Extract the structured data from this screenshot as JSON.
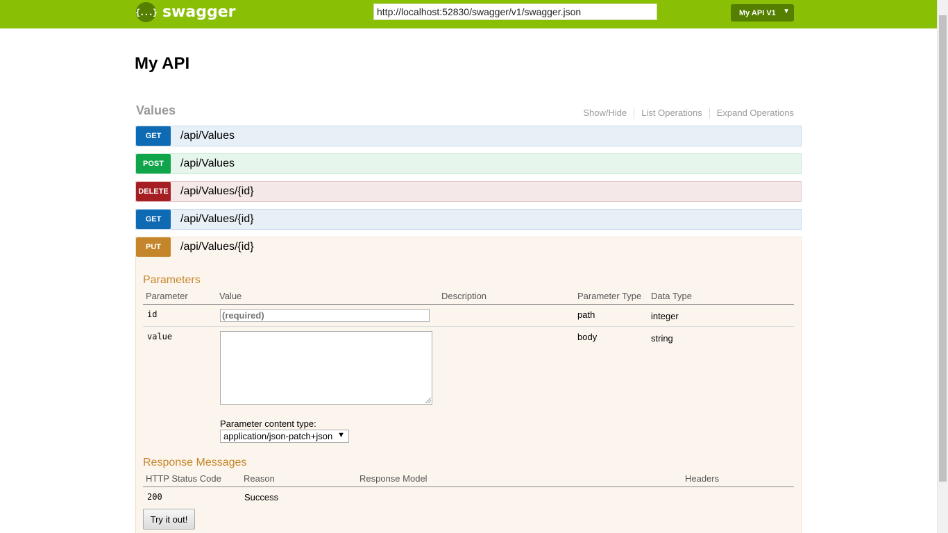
{
  "header": {
    "logo_icon_glyph": "{...}",
    "logo_text": "swagger",
    "url_value": "http://localhost:52830/swagger/v1/swagger.json",
    "api_selector": "My API V1",
    "background_color": "#89bf04"
  },
  "page_title": "My API",
  "section": {
    "title": "Values",
    "links": [
      "Show/Hide",
      "List Operations",
      "Expand Operations"
    ]
  },
  "operations": [
    {
      "verb": "GET",
      "path": "/api/Values",
      "color": "#0f6ab4"
    },
    {
      "verb": "POST",
      "path": "/api/Values",
      "color": "#10a54a"
    },
    {
      "verb": "DELETE",
      "path": "/api/Values/{id}",
      "color": "#a41e22"
    },
    {
      "verb": "GET",
      "path": "/api/Values/{id}",
      "color": "#0f6ab4"
    },
    {
      "verb": "PUT",
      "path": "/api/Values/{id}",
      "color": "#c5862b"
    }
  ],
  "put_details": {
    "parameters_heading": "Parameters",
    "param_columns": [
      "Parameter",
      "Value",
      "Description",
      "Parameter Type",
      "Data Type"
    ],
    "params": [
      {
        "name": "id",
        "placeholder": "(required)",
        "param_type": "path",
        "data_type": "integer"
      },
      {
        "name": "value",
        "param_type": "body",
        "data_type": "string"
      }
    ],
    "content_type_label": "Parameter content type:",
    "content_type_value": "application/json-patch+json",
    "responses_heading": "Response Messages",
    "response_columns": [
      "HTTP Status Code",
      "Reason",
      "Response Model",
      "Headers"
    ],
    "responses": [
      {
        "code": "200",
        "reason": "Success"
      }
    ],
    "try_button": "Try it out!"
  }
}
